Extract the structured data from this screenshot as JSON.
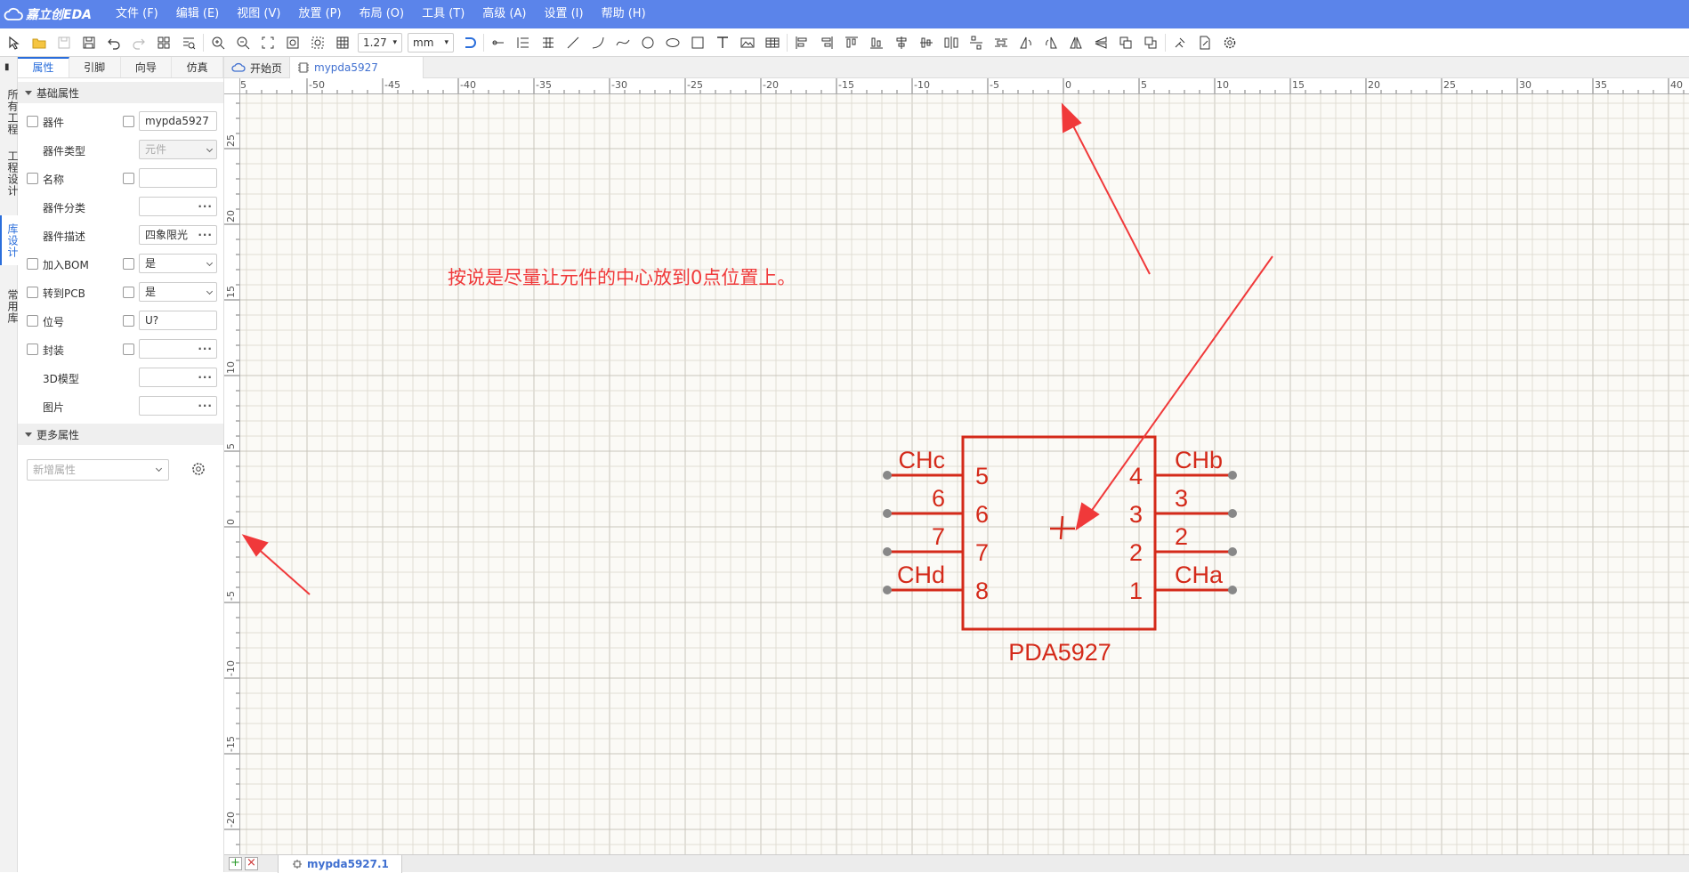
{
  "app": {
    "logo_text": "嘉立创EDA"
  },
  "menu": [
    "文件 (F)",
    "编辑 (E)",
    "视图 (V)",
    "放置 (P)",
    "布局 (O)",
    "工具 (T)",
    "高级 (A)",
    "设置 (I)",
    "帮助 (H)"
  ],
  "toolbar": {
    "grid_value": "1.27",
    "unit_value": "mm"
  },
  "vertical_tabs": [
    "所有工程",
    "工程设计",
    "库设计",
    "常用库"
  ],
  "panel": {
    "tabs": [
      "属性",
      "引脚",
      "向导",
      "仿真"
    ],
    "basic_section": "基础属性",
    "more_section": "更多属性",
    "new_attr_placeholder": "新增属性",
    "props": {
      "device": {
        "label": "器件",
        "value": "mypda5927"
      },
      "device_type": {
        "label": "器件类型",
        "value": "元件"
      },
      "name": {
        "label": "名称",
        "value": ""
      },
      "category": {
        "label": "器件分类",
        "value": ""
      },
      "description": {
        "label": "器件描述",
        "value": "四象限光"
      },
      "bom": {
        "label": "加入BOM",
        "value": "是"
      },
      "to_pcb": {
        "label": "转到PCB",
        "value": "是"
      },
      "designator": {
        "label": "位号",
        "value": "U?"
      },
      "footprint": {
        "label": "封装",
        "value": ""
      },
      "model3d": {
        "label": "3D模型",
        "value": ""
      },
      "image": {
        "label": "图片",
        "value": ""
      }
    }
  },
  "doc_tabs": {
    "start": "开始页",
    "symbol": "mypda5927"
  },
  "rulers": {
    "top": [
      "5",
      "-50",
      "-45",
      "-40",
      "-35",
      "-30",
      "-25",
      "-20",
      "-15",
      "-10",
      "-5",
      "0",
      "5",
      "10",
      "15",
      "20",
      "25",
      "30",
      "35",
      "40"
    ],
    "left": [
      "25",
      "20",
      "15",
      "10",
      "5",
      "0",
      "-5",
      "-10",
      "-15",
      "-20"
    ]
  },
  "annotation": {
    "note": "按说是尽量让元件的中心放到0点位置上。",
    "color": "#f0393a"
  },
  "symbol": {
    "name": "PDA5927",
    "color": "#d42a1a",
    "pins_left": [
      {
        "name": "CHc",
        "number": "5"
      },
      {
        "name": "6",
        "number": "6"
      },
      {
        "name": "7",
        "number": "7"
      },
      {
        "name": "CHd",
        "number": "8"
      }
    ],
    "pins_right": [
      {
        "name": "CHb",
        "number": "4"
      },
      {
        "name": "3",
        "number": "3"
      },
      {
        "name": "2",
        "number": "2"
      },
      {
        "name": "CHa",
        "number": "1"
      }
    ]
  },
  "bottom": {
    "sheet_tab": "mypda5927.1"
  },
  "colors": {
    "menubar": "#5b84ea",
    "accent": "#2a6edb",
    "grid_minor": "#e0ddd4",
    "grid_major": "#c8c5bc"
  }
}
